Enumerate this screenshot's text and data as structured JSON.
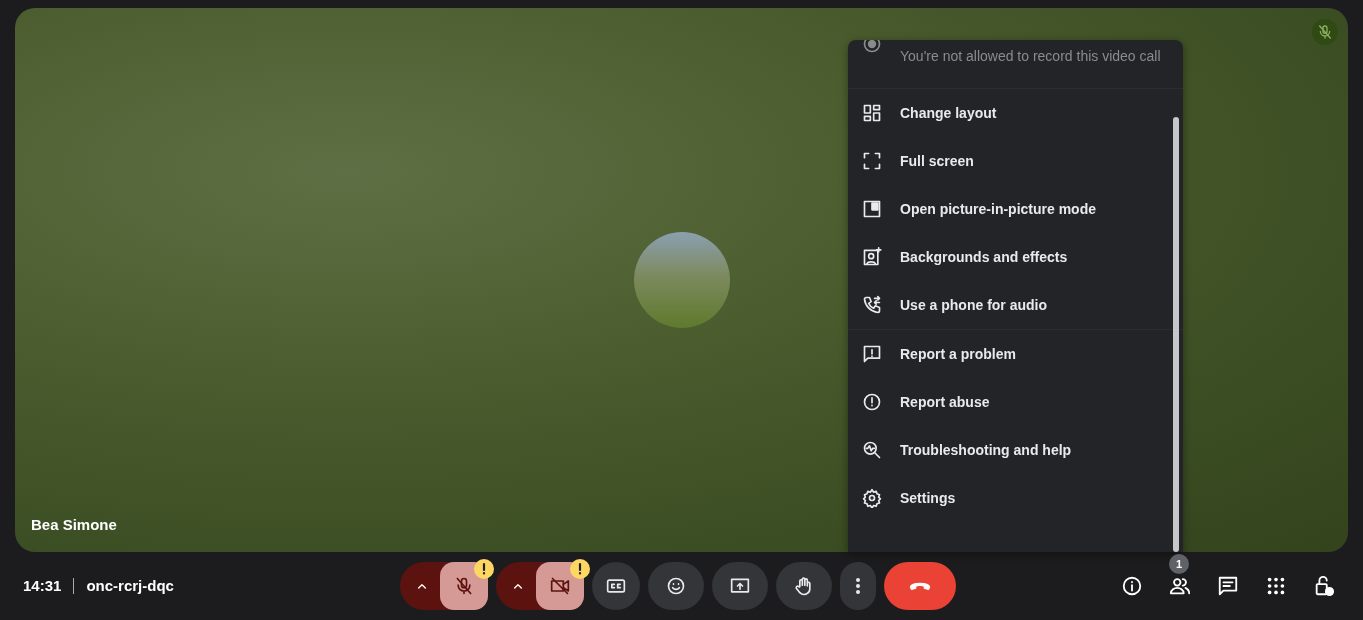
{
  "tile": {
    "name": "Bea Simone",
    "muted": true
  },
  "menu": {
    "groups": [
      [
        {
          "kind": "record",
          "label": "You're not allowed to record this video call",
          "disabled": true
        }
      ],
      [
        {
          "kind": "layout",
          "label": "Change layout",
          "disabled": false
        },
        {
          "kind": "fullscreen",
          "label": "Full screen",
          "disabled": false
        },
        {
          "kind": "pip",
          "label": "Open picture-in-picture mode",
          "disabled": false
        },
        {
          "kind": "effects",
          "label": "Backgrounds and effects",
          "disabled": false
        },
        {
          "kind": "phone",
          "label": "Use a phone for audio",
          "disabled": false
        }
      ],
      [
        {
          "kind": "problem",
          "label": "Report a problem",
          "disabled": false
        },
        {
          "kind": "abuse",
          "label": "Report abuse",
          "disabled": false
        },
        {
          "kind": "help",
          "label": "Troubleshooting and help",
          "disabled": false
        },
        {
          "kind": "settings",
          "label": "Settings",
          "disabled": false
        }
      ]
    ]
  },
  "bar": {
    "time": "14:31",
    "code": "onc-rcrj-dqc",
    "controls": [
      {
        "kind": "mic",
        "on": false,
        "warning": true
      },
      {
        "kind": "camera",
        "on": false,
        "warning": true
      },
      {
        "kind": "captions"
      },
      {
        "kind": "emoji"
      },
      {
        "kind": "present"
      },
      {
        "kind": "hand"
      },
      {
        "kind": "more"
      },
      {
        "kind": "hangup"
      }
    ],
    "side": [
      {
        "kind": "info"
      },
      {
        "kind": "people",
        "badge": "1"
      },
      {
        "kind": "chat"
      },
      {
        "kind": "apps"
      },
      {
        "kind": "lock"
      }
    ]
  }
}
